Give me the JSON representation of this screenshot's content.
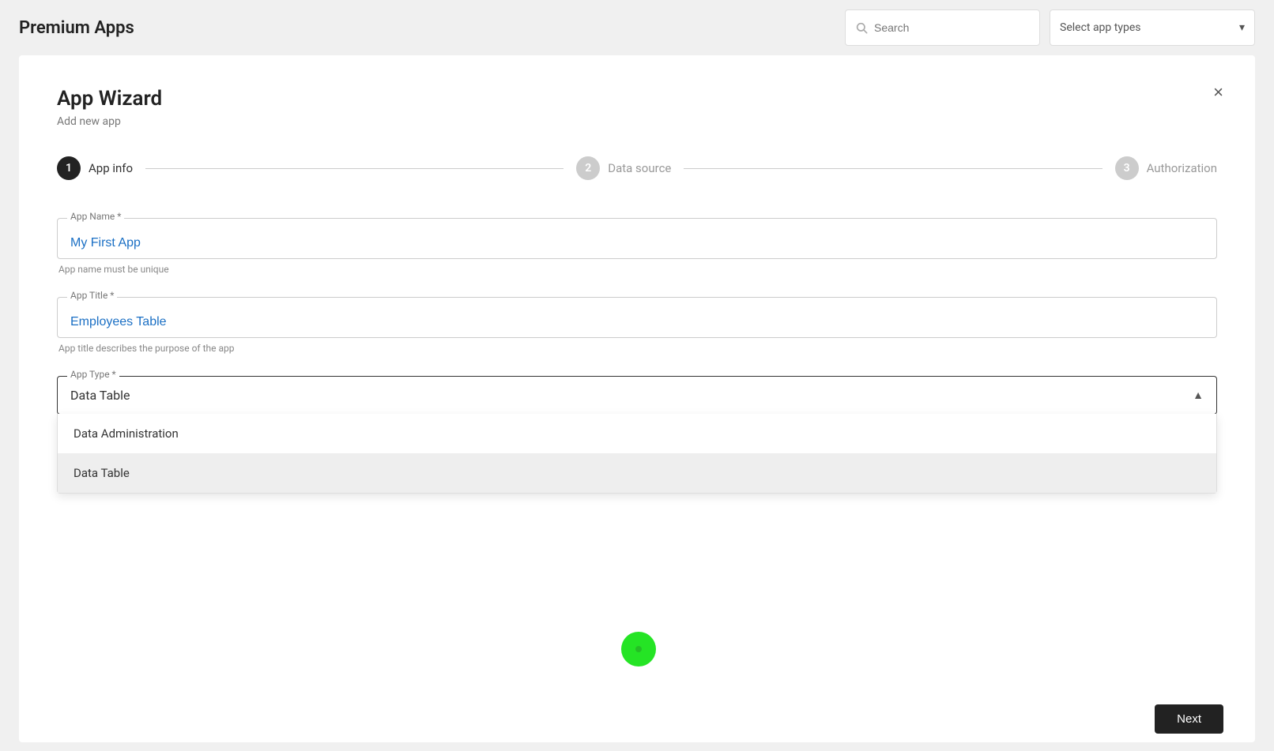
{
  "topbar": {
    "title": "Premium Apps",
    "search": {
      "placeholder": "Search"
    },
    "select_app_types": {
      "label": "Select app types",
      "chevron": "▾"
    }
  },
  "wizard": {
    "title": "App Wizard",
    "subtitle": "Add new app",
    "close_label": "×",
    "steps": [
      {
        "number": "1",
        "label": "App info",
        "state": "active"
      },
      {
        "number": "2",
        "label": "Data source",
        "state": "inactive"
      },
      {
        "number": "3",
        "label": "Authorization",
        "state": "inactive"
      }
    ],
    "fields": {
      "app_name": {
        "label": "App Name *",
        "value": "My First App",
        "hint": "App name must be unique"
      },
      "app_title": {
        "label": "App Title *",
        "value": "Employees Table",
        "hint": "App title describes the purpose of the app"
      },
      "app_type": {
        "label": "App Type *",
        "value": "Data Table",
        "chevron": "▲",
        "options": [
          {
            "label": "Data Administration",
            "selected": false
          },
          {
            "label": "Data Table",
            "selected": true
          }
        ]
      }
    },
    "next_button": "Next"
  }
}
